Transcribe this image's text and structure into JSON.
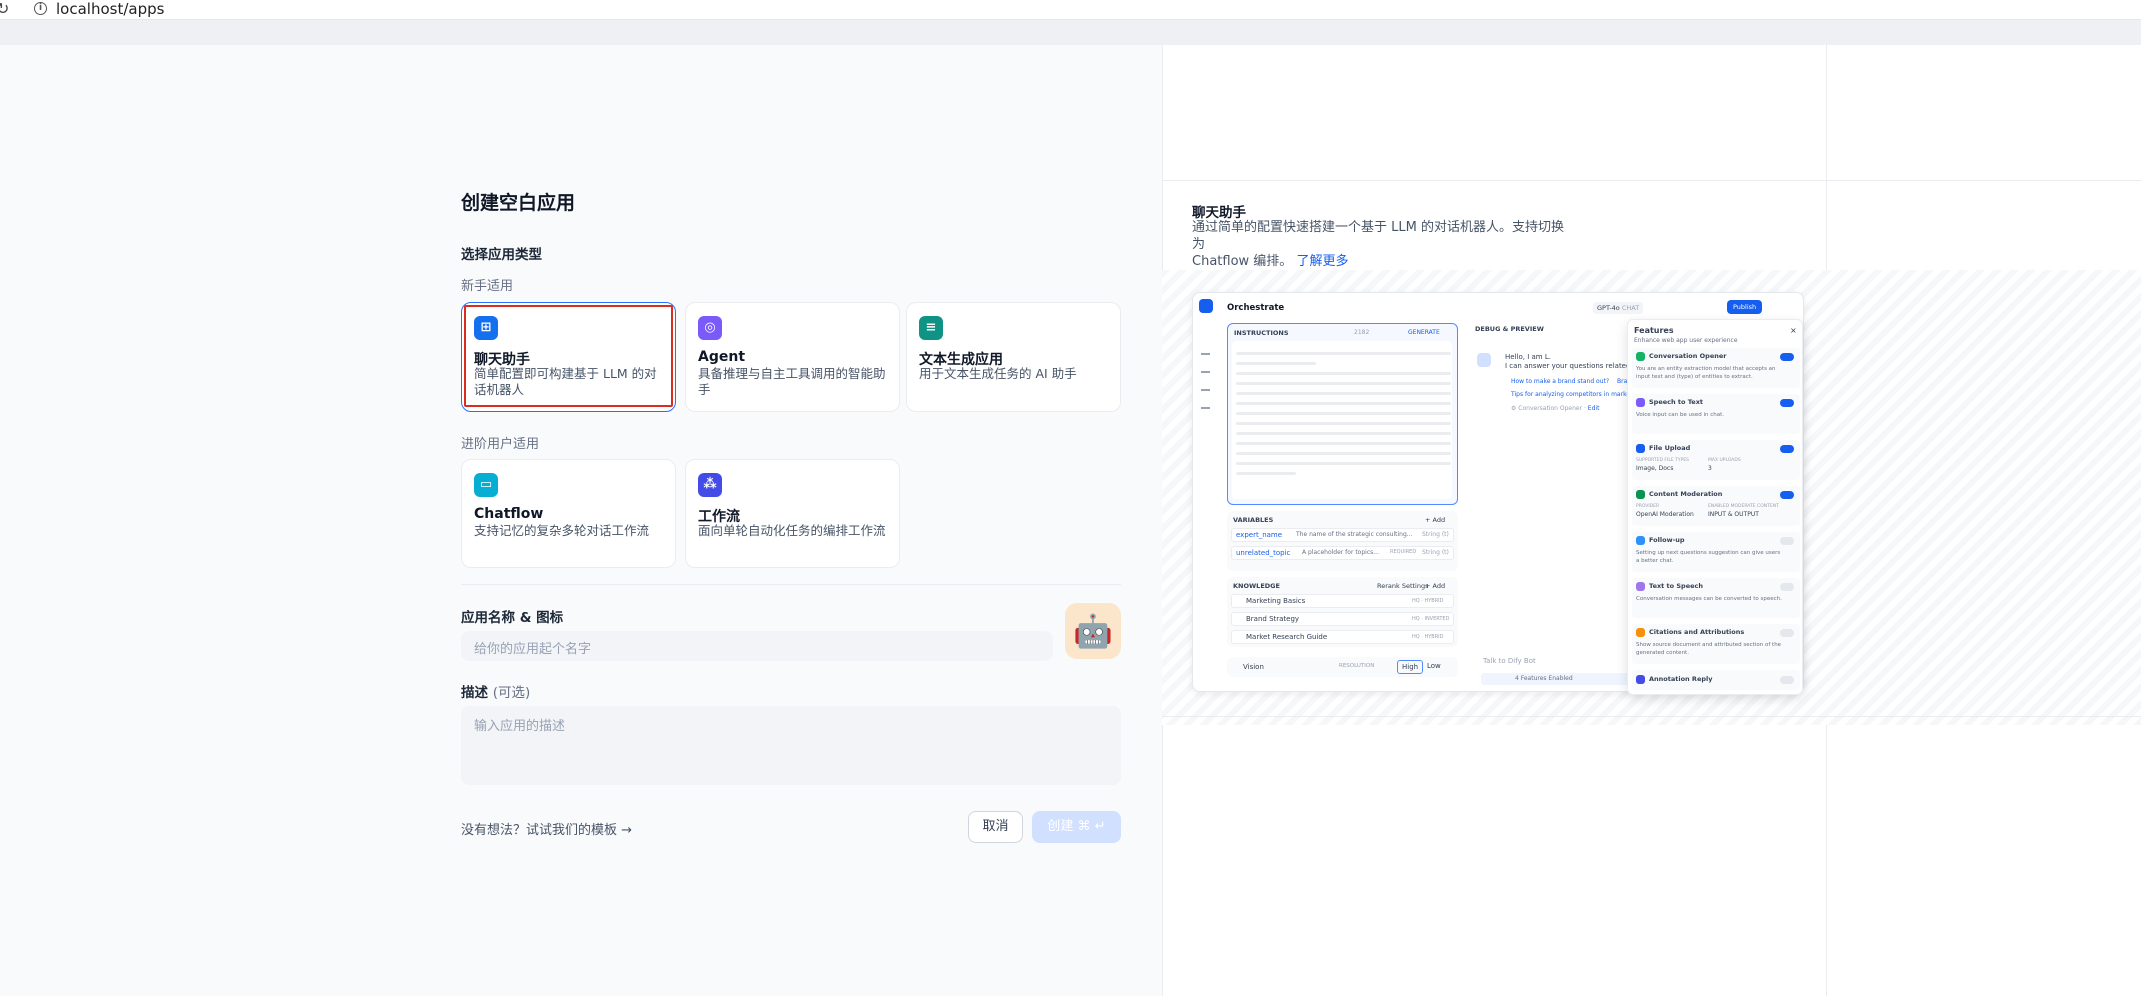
{
  "browser": {
    "url": "localhost/apps"
  },
  "page": {
    "title": "创建空白应用"
  },
  "app_type": {
    "heading": "选择应用类型",
    "beginner_label": "新手适用",
    "advanced_label": "进阶用户适用",
    "cards": [
      {
        "name": "聊天助手",
        "desc": "简单配置即可构建基于 LLM 的对话机器人",
        "color": "#1570ef",
        "icon": "chat-bot-icon"
      },
      {
        "name": "Agent",
        "desc": "具备推理与自主工具调用的智能助手",
        "color": "#7a5af8",
        "icon": "agent-icon"
      },
      {
        "name": "文本生成应用",
        "desc": "用于文本生成任务的 AI 助手",
        "color": "#0e9384",
        "icon": "text-generator-icon"
      },
      {
        "name": "Chatflow",
        "desc": "支持记忆的复杂多轮对话工作流",
        "color": "#06aed4",
        "icon": "chatflow-icon"
      },
      {
        "name": "工作流",
        "desc": "面向单轮自动化任务的编排工作流",
        "color": "#444ce7",
        "icon": "workflow-icon"
      }
    ]
  },
  "form": {
    "name_label": "应用名称 & 图标",
    "name_placeholder": "给你的应用起个名字",
    "desc_label": "描述",
    "desc_optional": "(可选)",
    "desc_placeholder": "输入应用的描述",
    "template_link": "没有想法？试试我们的模板 →",
    "cancel": "取消",
    "create": "创建 ⌘ ↵"
  },
  "preview": {
    "title": "聊天助手",
    "desc_line1": "通过简单的配置快速搭建一个基于 LLM 的对话机器人。支持切换为",
    "desc_line2": "Chatflow 编排。",
    "learn_more": "了解更多",
    "mock": {
      "orchestrate": "Orchestrate",
      "model": "GPT-4o",
      "model_tag": "CHAT",
      "publish": "Publish",
      "instructions": "INSTRUCTIONS",
      "instr_count": "2182",
      "generate": "GENERATE",
      "debug": "DEBUG & PREVIEW",
      "hello1": "Hello, I am L.",
      "hello2": "I can answer your questions related",
      "q1": "How to make a brand stand out?",
      "q1b": "Bra",
      "q2": "Tips for analyzing competitors in market",
      "opener": "Conversation Opener",
      "edit": "Edit",
      "variables": "VARIABLES",
      "add": "+ Add",
      "var1": "expert_name",
      "var1_desc": "The name of the strategic consulting...",
      "var1_type": "String (t)",
      "var2": "unrelated_topic",
      "var2_desc": "A placeholder for topics...",
      "var2_req": "REQUIRED",
      "var2_type": "String (t)",
      "knowledge": "KNOWLEDGE",
      "rerank": "Rerank Settings",
      "k1": "Marketing Basics",
      "k1_tag": "HQ · HYBRID",
      "k2": "Brand Strategy",
      "k2_tag": "HQ · INVERTED",
      "k3": "Market Research Guide",
      "k3_tag": "HQ · HYBRID",
      "vision": "Vision",
      "resolution": "RESOLUTION",
      "high": "High",
      "low": "Low",
      "talk": "Talk to Dify Bot",
      "features_enabled": "4 Features Enabled",
      "features_title": "Features",
      "features_sub": "Enhance web app user experience",
      "f1": "Conversation Opener",
      "f1d1": "You are an entity extraction model that accepts an",
      "f1d2": "input text and (type) of entities to extract.",
      "f2": "Speech to Text",
      "f2d": "Voice input can be used in chat.",
      "f3": "File Upload",
      "f3a": "SUPPORTED FILE TYPES",
      "f3b": "MAX UPLOADS",
      "f3c": "Image, Docs",
      "f3d": "3",
      "f4": "Content Moderation",
      "f4a": "PROVIDER",
      "f4b": "ENABLED MODERATE CONTENT",
      "f4c": "OpenAI Moderation",
      "f4d": "INPUT & OUTPUT",
      "f5": "Follow-up",
      "f5d1": "Setting up next questions suggestion can give users",
      "f5d2": "a better chat.",
      "f6": "Text to Speech",
      "f6d": "Conversation messages can be converted to speech.",
      "f7": "Citations and Attributions",
      "f7d1": "Show source document and attributed section of the",
      "f7d2": "generated content.",
      "f8": "Annotation Reply"
    }
  }
}
